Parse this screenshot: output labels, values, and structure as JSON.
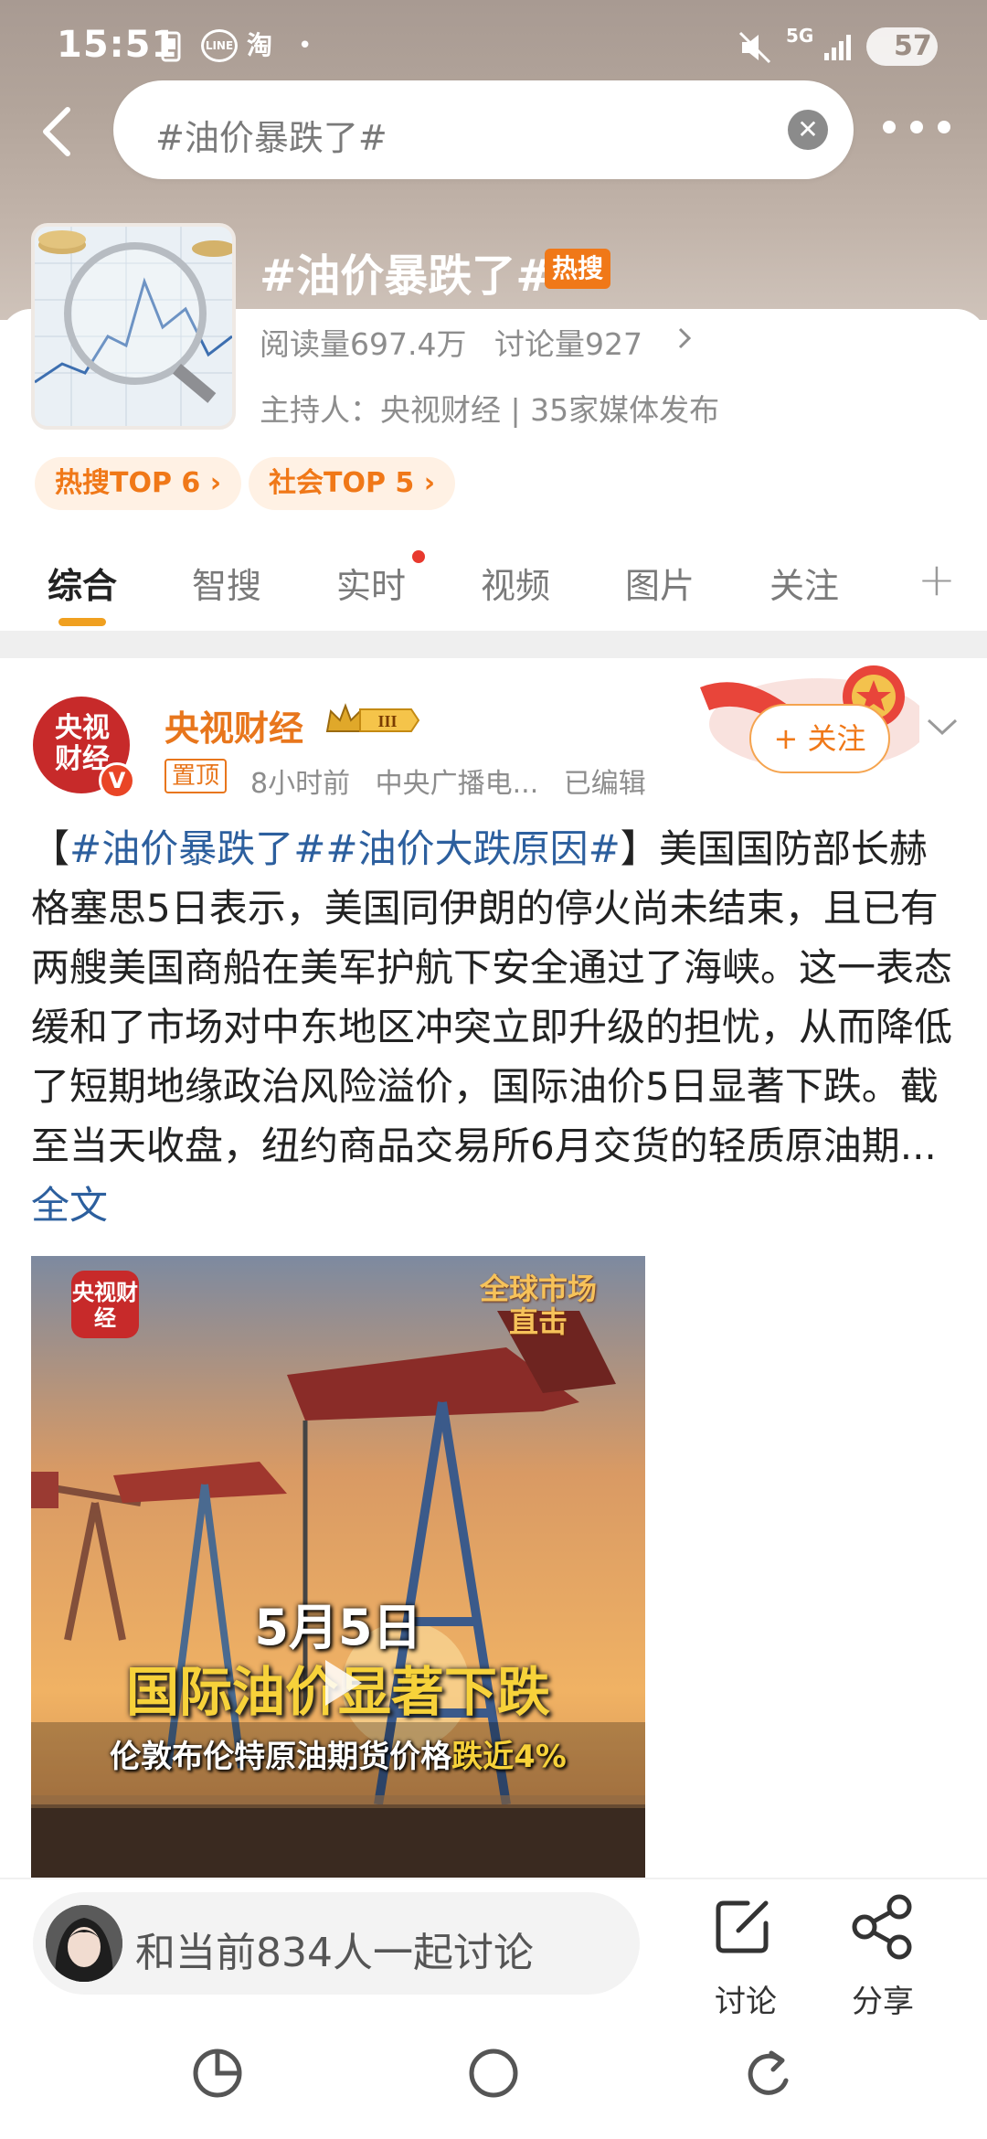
{
  "status_bar": {
    "time": "15:51",
    "notifications": [
      "sim-icon",
      "line-icon",
      "taobao-icon"
    ],
    "taobao_glyph": "淘",
    "line_glyph": "LINE",
    "dot": "•",
    "network": "5G",
    "battery": "57"
  },
  "search": {
    "query": "#油价暴跌了#"
  },
  "topic": {
    "title": "#油价暴跌了#",
    "hot_badge": "热搜",
    "read_count": "阅读量697.4万",
    "discuss_count": "讨论量927",
    "host_line": "主持人：央视财经 | 35家媒体发布",
    "chips": [
      "热搜TOP 6 ›",
      "社会TOP 5 ›"
    ]
  },
  "tabs": [
    {
      "label": "综合",
      "active": true
    },
    {
      "label": "智搜",
      "active": false
    },
    {
      "label": "实时",
      "active": false,
      "dot": true
    },
    {
      "label": "视频",
      "active": false
    },
    {
      "label": "图片",
      "active": false
    },
    {
      "label": "关注",
      "active": false
    }
  ],
  "tab_plus": "+",
  "post": {
    "author": "央视财经",
    "avatar_text": "央视财经",
    "verified_badge": "V",
    "level_badge": "III",
    "pinned": "置顶",
    "time": "8小时前",
    "source": "中央广播电...",
    "edited": "已编辑",
    "follow_button": "+ 关注",
    "text": {
      "bracket_open": "【",
      "hashtag1": "#油价暴跌了#",
      "hashtag2": "#油价大跌原因#",
      "bracket_close": "】",
      "body": "美国国防部长赫格塞思5日表示，美国同伊朗的停火尚未结束，且已有两艘美国商船在美军护航下安全通过了海峡。这一表态缓和了市场对中东地区冲突立即升级的担忧，从而降低了短期地缘政治风险溢价，国际油价5日显著下跌。截至当天收盘，纽约商品交易所6月交货的轻质原油期...",
      "full_text_link": "全文"
    },
    "video": {
      "logo_text": "央视财经",
      "brand_text": "全球市场直击",
      "date": "5月5日",
      "headline": "国际油价显著下跌",
      "subtitle_prefix": "伦敦布伦特原油期货价格",
      "subtitle_highlight": "跌近4%"
    }
  },
  "bottom": {
    "discuss_placeholder": "和当前834人一起讨论",
    "actions": [
      {
        "label": "讨论",
        "icon": "edit-icon"
      },
      {
        "label": "分享",
        "icon": "share-icon"
      }
    ]
  },
  "colors": {
    "accent_orange": "#f07818",
    "hashtag_blue": "#2c5f9e",
    "tab_underline": "#f0a020",
    "brand_red": "#c72a2a"
  }
}
